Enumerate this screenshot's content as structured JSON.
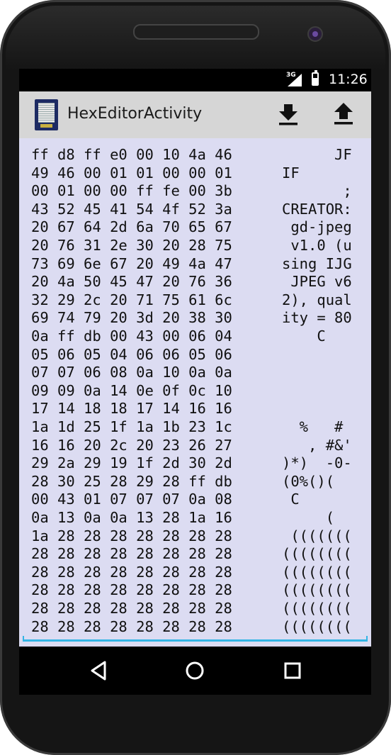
{
  "status_bar": {
    "network": "3G",
    "time": "11:26"
  },
  "action_bar": {
    "title": "HexEditorActivity",
    "icons": [
      "app-icon",
      "download-icon",
      "upload-icon"
    ]
  },
  "hex_rows": [
    {
      "hex": "ff d8 ff e0 00 10 4a 46",
      "ascii": "      JF"
    },
    {
      "hex": "49 46 00 01 01 00 00 01",
      "ascii": "IF"
    },
    {
      "hex": "00 01 00 00 ff fe 00 3b",
      "ascii": "       ;"
    },
    {
      "hex": "43 52 45 41 54 4f 52 3a",
      "ascii": "CREATOR:"
    },
    {
      "hex": "20 67 64 2d 6a 70 65 67",
      "ascii": " gd-jpeg"
    },
    {
      "hex": "20 76 31 2e 30 20 28 75",
      "ascii": " v1.0 (u"
    },
    {
      "hex": "73 69 6e 67 20 49 4a 47",
      "ascii": "sing IJG"
    },
    {
      "hex": "20 4a 50 45 47 20 76 36",
      "ascii": " JPEG v6"
    },
    {
      "hex": "32 29 2c 20 71 75 61 6c",
      "ascii": "2), qual"
    },
    {
      "hex": "69 74 79 20 3d 20 38 30",
      "ascii": "ity = 80"
    },
    {
      "hex": "0a ff db 00 43 00 06 04",
      "ascii": "    C"
    },
    {
      "hex": "05 06 05 04 06 06 05 06",
      "ascii": ""
    },
    {
      "hex": "07 07 06 08 0a 10 0a 0a",
      "ascii": ""
    },
    {
      "hex": "09 09 0a 14 0e 0f 0c 10",
      "ascii": ""
    },
    {
      "hex": "17 14 18 18 17 14 16 16",
      "ascii": ""
    },
    {
      "hex": "1a 1d 25 1f 1a 1b 23 1c",
      "ascii": "  %   #"
    },
    {
      "hex": "16 16 20 2c 20 23 26 27",
      "ascii": "   , #&'"
    },
    {
      "hex": "29 2a 29 19 1f 2d 30 2d",
      "ascii": ")*)  -0-"
    },
    {
      "hex": "28 30 25 28 29 28 ff db",
      "ascii": "(0%()("
    },
    {
      "hex": "00 43 01 07 07 07 0a 08",
      "ascii": " C"
    },
    {
      "hex": "0a 13 0a 0a 13 28 1a 16",
      "ascii": "     ("
    },
    {
      "hex": "1a 28 28 28 28 28 28 28",
      "ascii": " ((((((("
    },
    {
      "hex": "28 28 28 28 28 28 28 28",
      "ascii": "(((((((("
    },
    {
      "hex": "28 28 28 28 28 28 28 28",
      "ascii": "(((((((("
    },
    {
      "hex": "28 28 28 28 28 28 28 28",
      "ascii": "(((((((("
    },
    {
      "hex": "28 28 28 28 28 28 28 28",
      "ascii": "(((((((("
    },
    {
      "hex": "28 28 28 28 28 28 28 28",
      "ascii": "(((((((("
    }
  ],
  "nav_bar": {
    "icons": [
      "back-icon",
      "home-icon",
      "recents-icon"
    ]
  }
}
